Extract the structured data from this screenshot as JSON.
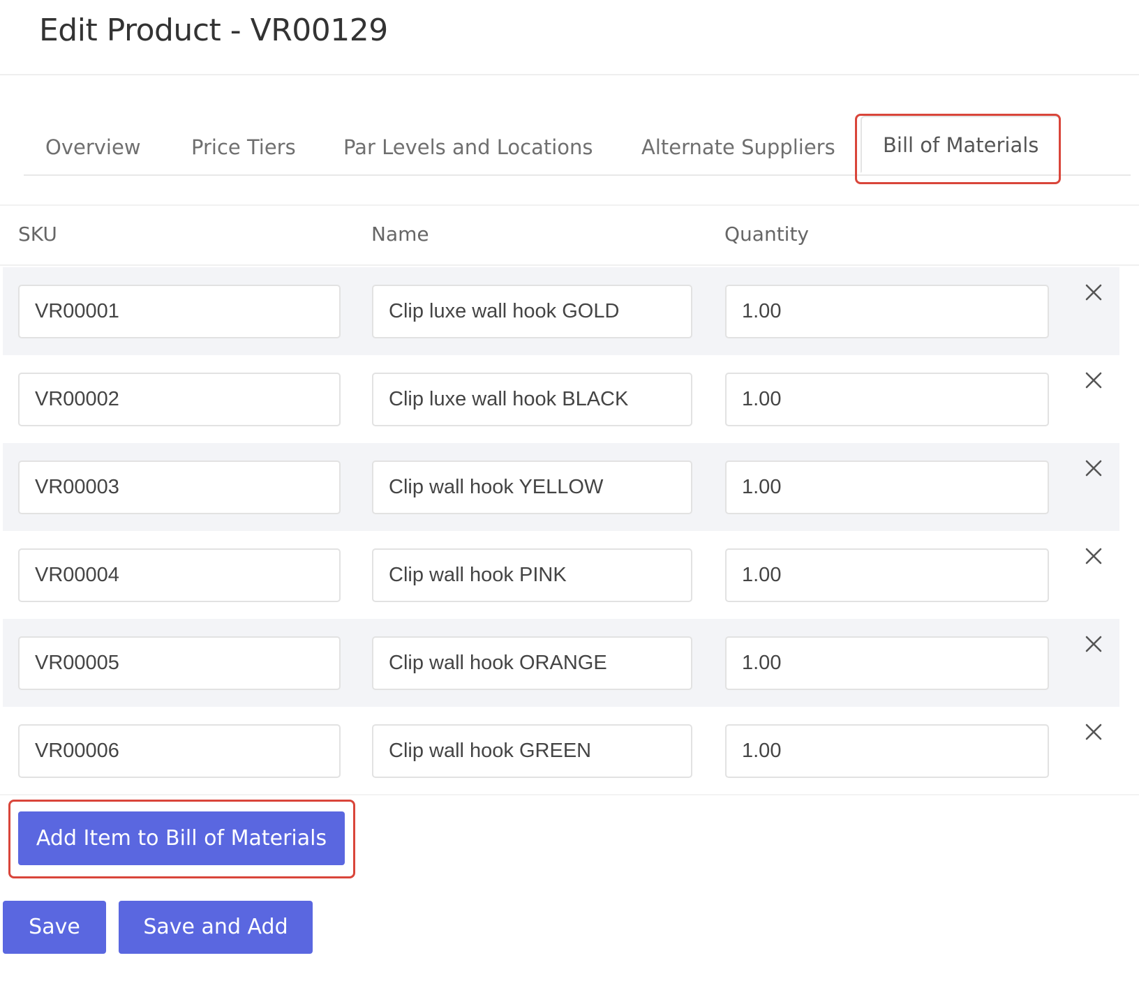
{
  "header": {
    "title": "Edit Product - VR00129"
  },
  "tabs": [
    {
      "label": "Overview",
      "active": false
    },
    {
      "label": "Price Tiers",
      "active": false
    },
    {
      "label": "Par Levels and Locations",
      "active": false
    },
    {
      "label": "Alternate Suppliers",
      "active": false
    },
    {
      "label": "Bill of Materials",
      "active": true
    }
  ],
  "bom": {
    "columns": {
      "sku": "SKU",
      "name": "Name",
      "quantity": "Quantity"
    },
    "rows": [
      {
        "sku": "VR00001",
        "name": "Clip luxe wall hook GOLD",
        "quantity": "1.00"
      },
      {
        "sku": "VR00002",
        "name": "Clip luxe wall hook BLACK",
        "quantity": "1.00"
      },
      {
        "sku": "VR00003",
        "name": "Clip wall hook YELLOW",
        "quantity": "1.00"
      },
      {
        "sku": "VR00004",
        "name": "Clip wall hook PINK",
        "quantity": "1.00"
      },
      {
        "sku": "VR00005",
        "name": "Clip wall hook ORANGE",
        "quantity": "1.00"
      },
      {
        "sku": "VR00006",
        "name": "Clip wall hook GREEN",
        "quantity": "1.00"
      }
    ],
    "remove_icon": "close-icon"
  },
  "actions": {
    "add_item_label": "Add Item to Bill of Materials",
    "save_label": "Save",
    "save_and_add_label": "Save and Add"
  },
  "colors": {
    "primary_button": "#5a67e0",
    "highlight_border": "#d9453a",
    "striped_row": "#f3f4f7"
  }
}
